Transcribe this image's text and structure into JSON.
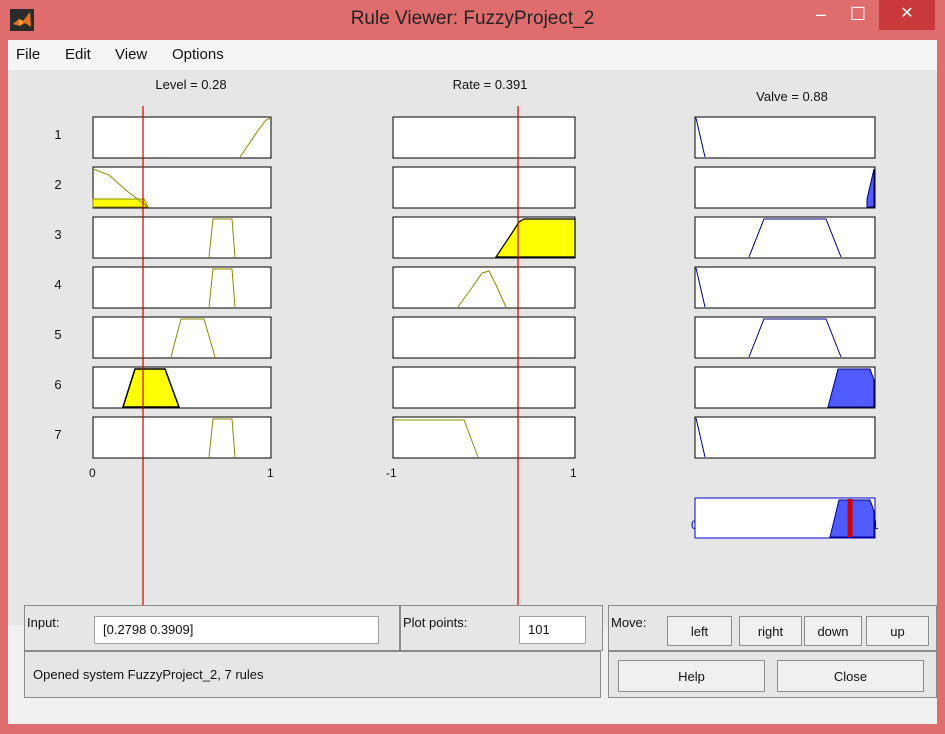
{
  "window": {
    "title": "Rule Viewer: FuzzyProject_2",
    "minimize_glyph": "–",
    "maximize_glyph": "☐",
    "close_glyph": "✕"
  },
  "menu": [
    "File",
    "Edit",
    "View",
    "Options"
  ],
  "variables": {
    "level": {
      "title": "Level = 0.28",
      "tick_min": "0",
      "tick_max": "1"
    },
    "rate": {
      "title": "Rate = 0.391",
      "tick_min": "-1",
      "tick_max": "1"
    },
    "valve": {
      "title": "Valve = 0.88",
      "tick_min": "0",
      "tick_max": "1"
    }
  },
  "rules": [
    "1",
    "2",
    "3",
    "4",
    "5",
    "6",
    "7"
  ],
  "controls": {
    "input_label": "Input:",
    "input_value": "[0.2798 0.3909]",
    "plot_points_label": "Plot points:",
    "plot_points_value": "101",
    "move_label": "Move:",
    "left": "left",
    "right": "right",
    "down": "down",
    "up": "up",
    "help": "Help",
    "close": "Close"
  },
  "status": "Opened system FuzzyProject_2, 7 rules",
  "colors": {
    "input_fill": "#ffff00",
    "input_line": "#8b8b00",
    "output_fill": "#4f5bff",
    "output_line": "#000080",
    "cursor": "#d00000",
    "titlebar": "#e06d6e"
  },
  "icons": [
    "matlab-logo-icon"
  ]
}
